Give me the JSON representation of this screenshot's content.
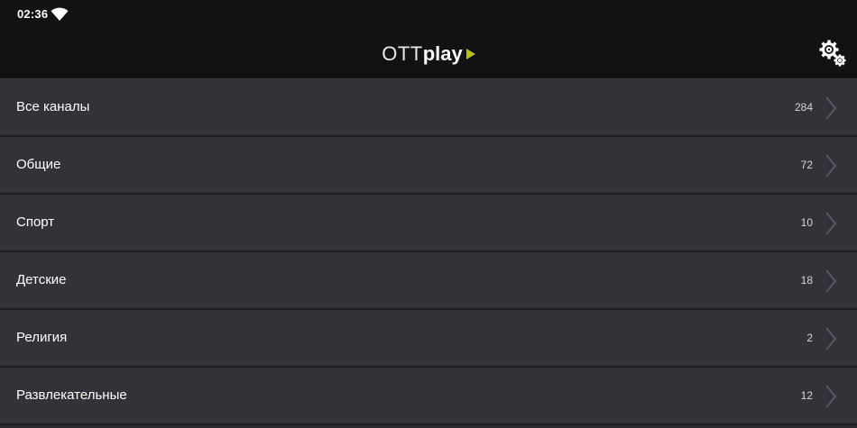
{
  "status_bar": {
    "time": "02:36",
    "wifi_icon": "wifi-icon"
  },
  "header": {
    "logo_part1": "OTT",
    "logo_part2": "play",
    "logo_accent_color": "#b7c21a",
    "settings_icon": "gears-icon"
  },
  "categories": [
    {
      "label": "Все каналы",
      "count": "284"
    },
    {
      "label": "Общие",
      "count": "72"
    },
    {
      "label": "Спорт",
      "count": "10"
    },
    {
      "label": "Детские",
      "count": "18"
    },
    {
      "label": "Религия",
      "count": "2"
    },
    {
      "label": "Развлекательные",
      "count": "12"
    }
  ],
  "colors": {
    "header_bg": "#111214",
    "row_bg": "#333239",
    "divider": "#1c1b20"
  }
}
